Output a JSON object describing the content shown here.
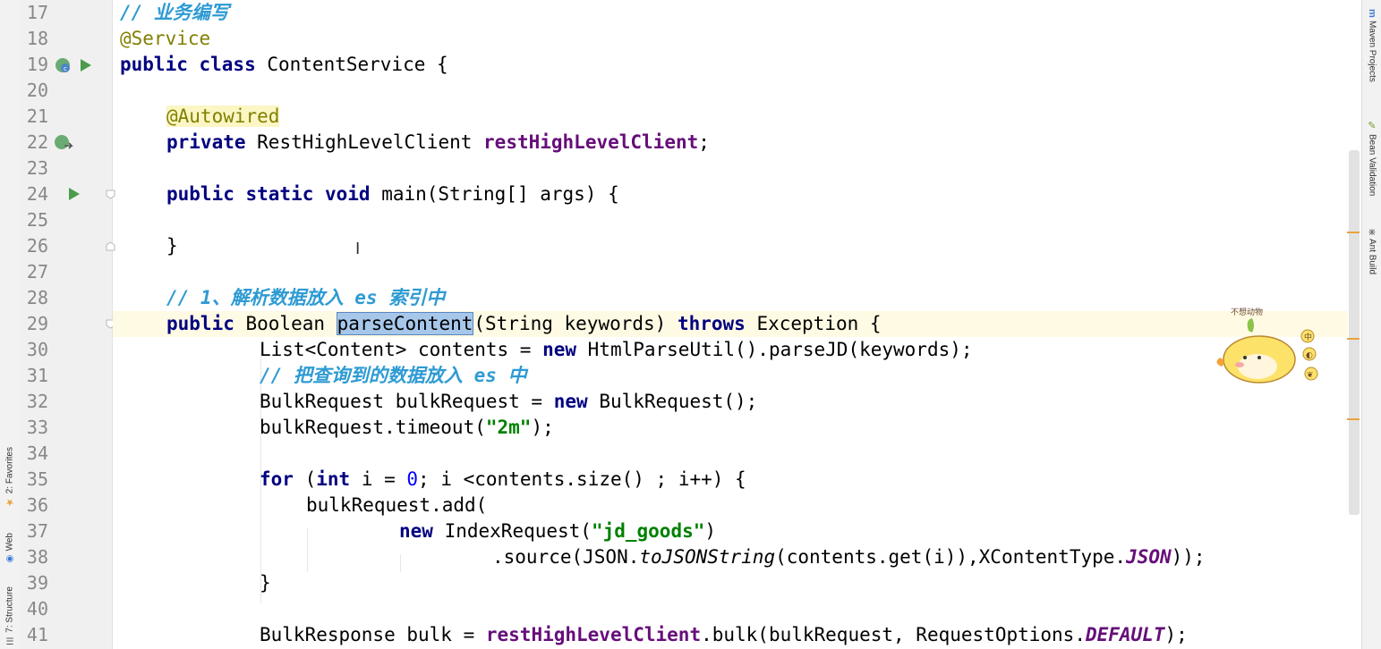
{
  "editor": {
    "line_numbers": [
      "17",
      "18",
      "19",
      "20",
      "21",
      "22",
      "23",
      "24",
      "25",
      "26",
      "27",
      "28",
      "29",
      "30",
      "31",
      "32",
      "33",
      "34",
      "35",
      "36",
      "37",
      "38",
      "39",
      "40",
      "41"
    ],
    "code": {
      "l17_comment": "// 业务编写",
      "l18_annotation": "@Service",
      "l19_kw": "public class",
      "l19_rest": " ContentService {",
      "l21_annotation": "@Autowired",
      "l22_kw": "private",
      "l22_type": " RestHighLevelClient ",
      "l22_field": "restHighLevelClient",
      "l22_end": ";",
      "l24_kw": "public static void",
      "l24_rest": " main(String[] args) {",
      "l26_brace": "}",
      "l28_comment": "// 1、解析数据放入 es 索引中",
      "l29_kw": "public",
      "l29_type": " Boolean ",
      "l29_method": "parseContent",
      "l29_params": "(String keywords) ",
      "l29_throws": "throws",
      "l29_end": " Exception {",
      "l30_a": "List<Content> contents = ",
      "l30_new": "new",
      "l30_b": " HtmlParseUtil().parseJD(keywords);",
      "l31_comment": "// 把查询到的数据放入 es 中",
      "l32_a": "BulkRequest bulkRequest = ",
      "l32_new": "new",
      "l32_b": " BulkRequest();",
      "l33_a": "bulkRequest.timeout(",
      "l33_str": "\"2m\"",
      "l33_b": ");",
      "l35_for": "for",
      "l35_a": " (",
      "l35_int": "int",
      "l35_b": " i = ",
      "l35_zero": "0",
      "l35_c": "; i <contents.size() ; i++) {",
      "l36": "bulkRequest.add(",
      "l37_new": "new",
      "l37_a": " IndexRequest(",
      "l37_str": "\"jd_goods\"",
      "l37_b": ")",
      "l38_a": ".source(JSON.",
      "l38_it": "toJSONString",
      "l38_b": "(contents.get(i)),XContentType.",
      "l38_json": "JSON",
      "l38_c": "));",
      "l39_brace": "}",
      "l41_a": "BulkResponse bulk = ",
      "l41_field": "restHighLevelClient",
      "l41_b": ".bulk(bulkRequest, RequestOptions.",
      "l41_default": "DEFAULT",
      "l41_c": ");"
    }
  },
  "left_tools": {
    "favorites": "2: Favorites",
    "web": "Web",
    "structure": "7: Structure"
  },
  "right_tools": {
    "maven": "Maven Projects",
    "bean": "Bean Validation",
    "ant": "Ant Build"
  },
  "sticker": {
    "caption": "不想动物",
    "badges": [
      "中",
      "◐",
      "❦"
    ]
  },
  "colors": {
    "keyword": "#000080",
    "comment": "#2e9bd3",
    "annotation": "#808000",
    "field": "#660e7a",
    "string": "#008000",
    "number": "#0000ff",
    "run_icon": "#4a9c4a"
  }
}
